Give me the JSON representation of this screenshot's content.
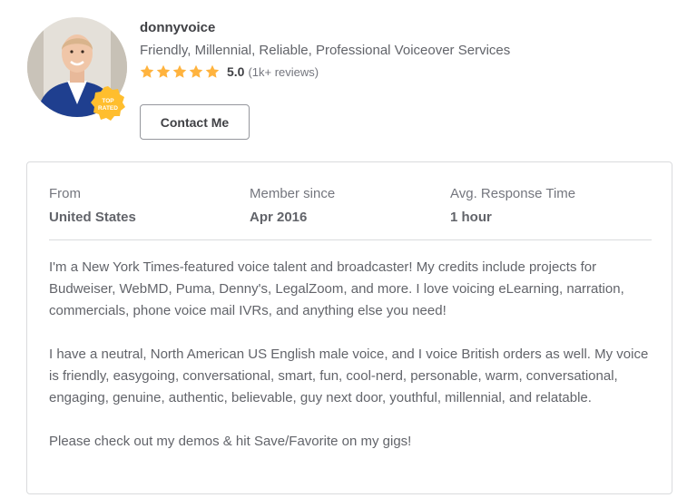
{
  "profile": {
    "username": "donnyvoice",
    "tagline": "Friendly, Millennial, Reliable, Professional Voiceover Services",
    "badge_line1": "TOP",
    "badge_line2": "RATED",
    "stars": 5,
    "rating": "5.0",
    "reviews": "(1k+ reviews)",
    "contact_label": "Contact Me"
  },
  "stats": [
    {
      "label": "From",
      "value": "United States"
    },
    {
      "label": "Member since",
      "value": "Apr 2016"
    },
    {
      "label": "Avg. Response Time",
      "value": "1 hour"
    }
  ],
  "description": [
    "I'm a New York Times-featured voice talent and broadcaster! My credits include projects for Budweiser, WebMD, Puma, Denny's, LegalZoom, and more. I love voicing eLearning, narration, commercials, phone voice mail IVRs, and anything else you need!",
    "I have a neutral, North American US English male voice, and I voice British orders as well. My voice is friendly, easygoing, conversational, smart, fun, cool-nerd, personable, warm, conversational, engaging, genuine, authentic, believable, guy next door, youthful, millennial, and relatable.",
    "Please check out my demos & hit Save/Favorite on my gigs!"
  ],
  "colors": {
    "star": "#ffb33e",
    "badge": "#ffbe2e"
  },
  "icons": {
    "star": "star-icon",
    "badge": "top-rated-badge-icon"
  }
}
